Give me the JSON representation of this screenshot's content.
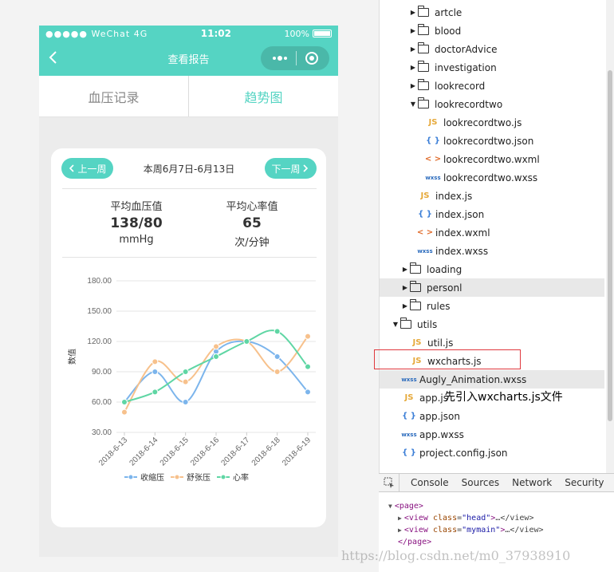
{
  "phone": {
    "status": {
      "signal": "●●●●● WeChat 4G",
      "time": "11:02",
      "battery": "100%"
    },
    "nav": {
      "title": "查看报告"
    },
    "tabs": [
      {
        "label": "血压记录",
        "active": false
      },
      {
        "label": "趋势图",
        "active": true
      }
    ],
    "week": {
      "prev": "上一周",
      "range": "本周6月7日-6月13日",
      "next": "下一周"
    },
    "stats": [
      {
        "label": "平均血压值",
        "value": "138/80",
        "unit": "mmHg"
      },
      {
        "label": "平均心率值",
        "value": "65",
        "unit": "次/分钟"
      }
    ]
  },
  "chart_data": {
    "type": "line",
    "categories": [
      "2018-6-13",
      "2018-6-14",
      "2018-6-15",
      "2018-6-16",
      "2018-6-17",
      "2018-6-18",
      "2018-6-19"
    ],
    "series": [
      {
        "name": "收缩压",
        "color": "#7cb5ec",
        "values": [
          60,
          90,
          60,
          110,
          120,
          105,
          70
        ]
      },
      {
        "name": "舒张压",
        "color": "#f7c18c",
        "values": [
          50,
          100,
          80,
          115,
          120,
          90,
          125
        ]
      },
      {
        "name": "心率",
        "color": "#5fd6a4",
        "values": [
          60,
          70,
          90,
          105,
          120,
          130,
          95
        ]
      }
    ],
    "yticks": [
      "180.00",
      "150.00",
      "120.00",
      "90.00",
      "60.00",
      "30.00"
    ],
    "ylim": [
      30,
      180
    ],
    "ylabel": "数值",
    "grid": true,
    "legend": "bottom"
  },
  "filetree": {
    "rows": [
      {
        "kind": "folder",
        "open": false,
        "name": "artcle"
      },
      {
        "kind": "folder",
        "open": false,
        "name": "blood"
      },
      {
        "kind": "folder",
        "open": false,
        "name": "doctorAdvice"
      },
      {
        "kind": "folder",
        "open": false,
        "name": "investigation"
      },
      {
        "kind": "folder",
        "open": false,
        "name": "lookrecord"
      },
      {
        "kind": "folder",
        "open": true,
        "name": "lookrecordtwo"
      },
      {
        "kind": "js",
        "name": "lookrecordtwo.js"
      },
      {
        "kind": "json",
        "name": "lookrecordtwo.json"
      },
      {
        "kind": "wxml",
        "name": "lookrecordtwo.wxml"
      },
      {
        "kind": "wxss",
        "name": "lookrecordtwo.wxss"
      },
      {
        "kind": "js",
        "name": "index.js"
      },
      {
        "kind": "json",
        "name": "index.json"
      },
      {
        "kind": "wxml",
        "name": "index.wxml"
      },
      {
        "kind": "wxss",
        "name": "index.wxss"
      },
      {
        "kind": "folder",
        "open": false,
        "name": "loading"
      },
      {
        "kind": "folder",
        "open": false,
        "name": "personl",
        "highlight": true
      },
      {
        "kind": "folder",
        "open": false,
        "name": "rules"
      },
      {
        "kind": "folder",
        "open": true,
        "name": "utils"
      },
      {
        "kind": "js",
        "name": "util.js"
      },
      {
        "kind": "js",
        "name": "wxcharts.js"
      },
      {
        "kind": "wxss",
        "name": "Augly_Animation.wxss",
        "highlight": true
      },
      {
        "kind": "js",
        "name": "app.js"
      },
      {
        "kind": "json",
        "name": "app.json"
      },
      {
        "kind": "wxss",
        "name": "app.wxss"
      },
      {
        "kind": "json",
        "name": "project.config.json"
      }
    ],
    "type_labels": {
      "js": "JS",
      "json": "{ }",
      "wxml": "< >",
      "wxss": "wxss"
    },
    "annotation": "先引入wxcharts.js文件"
  },
  "devtools": {
    "tabs": [
      "Console",
      "Sources",
      "Network",
      "Security"
    ],
    "dom": [
      {
        "open": "<page>"
      },
      {
        "tag": "view",
        "attr": "class",
        "val": "head",
        "rest": "…</view>"
      },
      {
        "tag": "view",
        "attr": "class",
        "val": "mymain",
        "rest": "…</view>"
      },
      {
        "close": "</page>"
      }
    ]
  },
  "watermark": "https://blog.csdn.net/m0_37938910"
}
